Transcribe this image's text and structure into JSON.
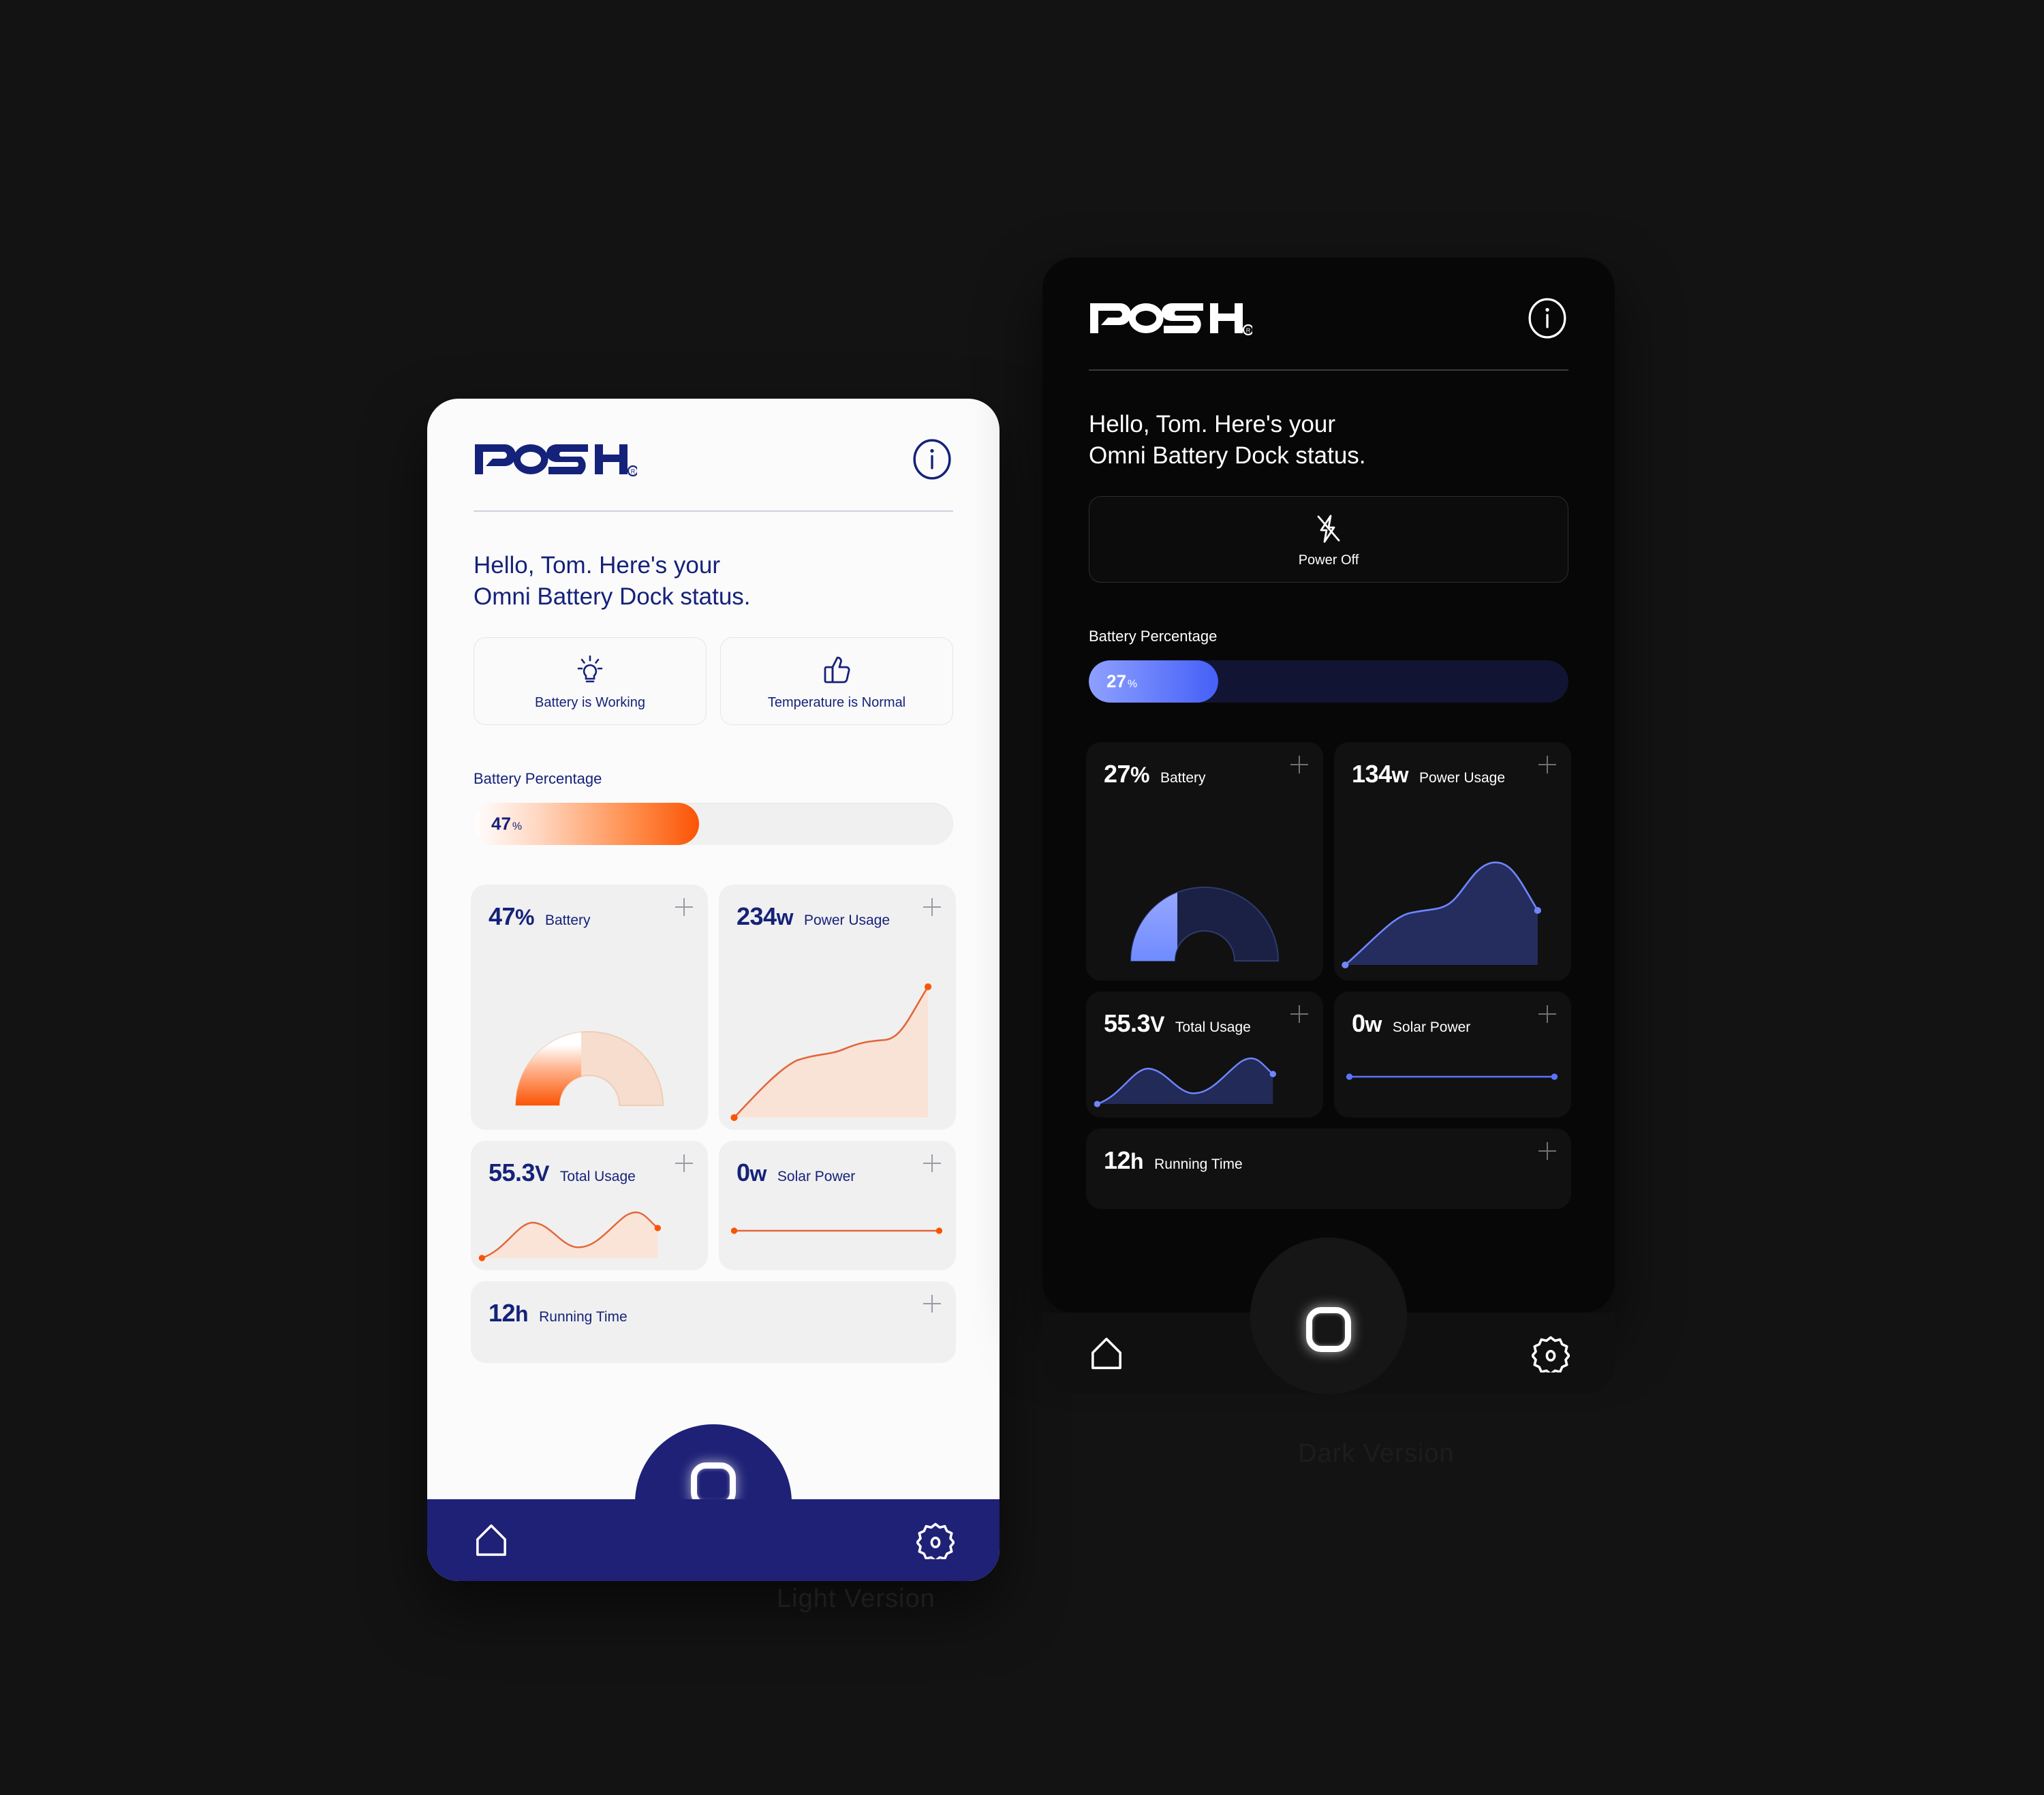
{
  "captions": {
    "light": "Light Version",
    "dark": "Dark Version"
  },
  "brand": {
    "name": "POSH",
    "registered": "®"
  },
  "colors": {
    "light_accent": "#15227a",
    "light_orange": "#fb5405",
    "dark_accent": "#4460f7",
    "nav_navy": "#1e2176"
  },
  "light_phone": {
    "header": {
      "logo_text": "POSH",
      "info_icon": "info-icon"
    },
    "greeting": "Hello, Tom. Here's your\nOmni Battery Dock status.",
    "chips": [
      {
        "icon": "lightbulb-icon",
        "label": "Battery is Working"
      },
      {
        "icon": "thumbs-up-icon",
        "label": "Temperature is Normal"
      }
    ],
    "battery_percentage": {
      "title": "Battery Percentage",
      "value": "47",
      "unit": "%",
      "fill_percent": 47
    },
    "cards": [
      {
        "value": "47",
        "unit": "%",
        "name": "Battery",
        "add": "plus-icon",
        "chart": "gauge"
      },
      {
        "value": "234",
        "unit": "w",
        "name": "Power Usage",
        "add": "plus-icon",
        "chart": "area-rising"
      },
      {
        "value": "55.3",
        "unit": "V",
        "name": "Total Usage",
        "add": "plus-icon",
        "chart": "area-wave"
      },
      {
        "value": "0",
        "unit": "w",
        "name": "Solar Power",
        "add": "plus-icon",
        "chart": "flat-line"
      },
      {
        "value": "12",
        "unit": "h",
        "name": "Running Time",
        "add": "plus-icon",
        "chart": "none"
      }
    ],
    "nav": [
      {
        "icon": "home-icon",
        "name": "nav-home"
      },
      {
        "icon": "home-ring-icon",
        "name": "nav-center"
      },
      {
        "icon": "gear-icon",
        "name": "nav-settings"
      }
    ]
  },
  "dark_phone": {
    "header": {
      "logo_text": "POSH",
      "info_icon": "info-icon"
    },
    "greeting": "Hello, Tom. Here's your\nOmni Battery Dock status.",
    "power": {
      "icon": "flash-off-icon",
      "label": "Power Off"
    },
    "battery_percentage": {
      "title": "Battery Percentage",
      "value": "27",
      "unit": "%",
      "fill_percent": 27
    },
    "cards": [
      {
        "value": "27",
        "unit": "%",
        "name": "Battery",
        "add": "plus-icon",
        "chart": "gauge"
      },
      {
        "value": "134",
        "unit": "w",
        "name": "Power Usage",
        "add": "plus-icon",
        "chart": "area-rising"
      },
      {
        "value": "55.3",
        "unit": "V",
        "name": "Total Usage",
        "add": "plus-icon",
        "chart": "area-wave"
      },
      {
        "value": "0",
        "unit": "w",
        "name": "Solar Power",
        "add": "plus-icon",
        "chart": "flat-line"
      },
      {
        "value": "12",
        "unit": "h",
        "name": "Running Time",
        "add": "plus-icon",
        "chart": "none"
      }
    ],
    "nav": [
      {
        "icon": "home-icon",
        "name": "nav-home"
      },
      {
        "icon": "home-ring-icon",
        "name": "nav-center"
      },
      {
        "icon": "gear-icon",
        "name": "nav-settings"
      }
    ]
  },
  "chart_data": [
    {
      "type": "gauge",
      "title": "Battery",
      "value": 47,
      "max": 100,
      "unit": "%",
      "theme": "light"
    },
    {
      "type": "area",
      "title": "Power Usage",
      "value": 234,
      "unit": "w",
      "x": [
        0,
        1,
        2,
        3,
        4,
        5,
        6,
        7
      ],
      "values": [
        0,
        30,
        42,
        44,
        72,
        74,
        76,
        100
      ],
      "ylim": [
        0,
        100
      ],
      "grid": false,
      "theme": "light"
    },
    {
      "type": "area",
      "title": "Total Usage",
      "value": 55.3,
      "unit": "V",
      "x": [
        0,
        1,
        2,
        3,
        4,
        5,
        6
      ],
      "values": [
        0,
        58,
        42,
        30,
        52,
        74,
        58
      ],
      "ylim": [
        0,
        100
      ],
      "grid": false,
      "theme": "light"
    },
    {
      "type": "line",
      "title": "Solar Power",
      "value": 0,
      "unit": "w",
      "x": [
        0,
        1
      ],
      "values": [
        0,
        0
      ],
      "ylim": [
        0,
        100
      ],
      "grid": false,
      "theme": "light"
    },
    {
      "type": "gauge",
      "title": "Battery",
      "value": 27,
      "max": 100,
      "unit": "%",
      "theme": "dark"
    },
    {
      "type": "area",
      "title": "Power Usage",
      "value": 134,
      "unit": "w",
      "x": [
        0,
        1,
        2,
        3,
        4,
        5,
        6,
        7
      ],
      "values": [
        0,
        34,
        52,
        56,
        88,
        90,
        60,
        58
      ],
      "ylim": [
        0,
        100
      ],
      "grid": false,
      "theme": "dark"
    },
    {
      "type": "area",
      "title": "Total Usage",
      "value": 55.3,
      "unit": "V",
      "x": [
        0,
        1,
        2,
        3,
        4,
        5,
        6
      ],
      "values": [
        0,
        58,
        42,
        30,
        52,
        74,
        58
      ],
      "ylim": [
        0,
        100
      ],
      "grid": false,
      "theme": "dark"
    },
    {
      "type": "line",
      "title": "Solar Power",
      "value": 0,
      "unit": "w",
      "x": [
        0,
        1
      ],
      "values": [
        0,
        0
      ],
      "ylim": [
        0,
        100
      ],
      "grid": false,
      "theme": "dark"
    }
  ]
}
